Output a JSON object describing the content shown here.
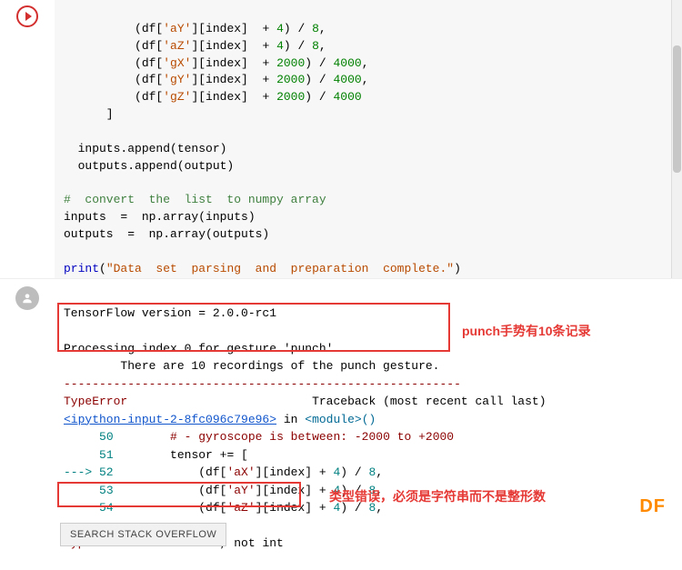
{
  "code": {
    "lines": [
      "          (df['aY'][index]  + 4) / 8,",
      "          (df['aZ'][index]  + 4) / 8,",
      "          (df['gX'][index]  + 2000) / 4000,",
      "          (df['gY'][index]  + 2000) / 4000,",
      "          (df['gZ'][index]  + 2000) / 4000",
      "      ]",
      "",
      "  inputs.append(tensor)",
      "  outputs.append(output)",
      "",
      "#  convert  the  list  to numpy array",
      "inputs  =  np.array(inputs)",
      "outputs  =  np.array(outputs)",
      "",
      "print(\"Data  set  parsing  and  preparation  complete.\")"
    ]
  },
  "output": {
    "tf_version_line": "TensorFlow version = 2.0.0-rc1",
    "processing_line1": "Processing index 0 for gesture 'punch'.",
    "processing_line2": "        There are 10 recordings of the punch gesture.",
    "sep": "--------------------------------------------------------",
    "err_type": "TypeError",
    "traceback_tail": "Traceback (most recent call last)",
    "ipython_ref": "<ipython-input-2-8fc096c79e96>",
    "in_word": " in ",
    "module_ref": "<module>",
    "paren": "()",
    "tb_lines": [
      {
        "ln": "50",
        "arrow": "     ",
        "text": "        # - gyroscope is between: -2000 to +2000",
        "cls": "comment-trace"
      },
      {
        "ln": "51",
        "arrow": "     ",
        "text": "        tensor += [",
        "cls": ""
      },
      {
        "ln": "52",
        "arrow": "---> ",
        "text": "            (df['aX'][index] + 4) / 8,",
        "cls": ""
      },
      {
        "ln": "53",
        "arrow": "     ",
        "text": "            (df['aY'][index] + 4) / 8,",
        "cls": ""
      },
      {
        "ln": "54",
        "arrow": "     ",
        "text": "            (df['aZ'][index] + 4) / 8,",
        "cls": ""
      }
    ],
    "final_err": "TypeError: must be str, not int"
  },
  "annotations": {
    "anno1": "punch手势有10条记录",
    "anno2": "类型错误，必须是字符串而不是整形数"
  },
  "buttons": {
    "search_so": "SEARCH STACK OVERFLOW"
  },
  "logo": "DF"
}
